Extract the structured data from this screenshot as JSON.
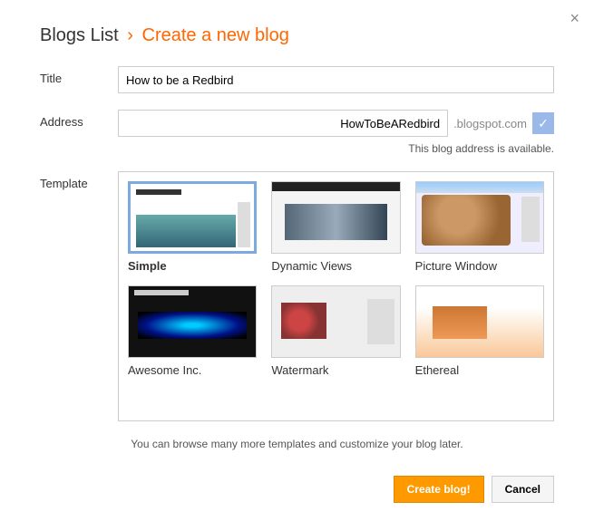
{
  "breadcrumb": {
    "prev": "Blogs List",
    "sep": "›",
    "current": "Create a new blog"
  },
  "labels": {
    "title": "Title",
    "address": "Address",
    "template": "Template"
  },
  "title_value": "How to be a Redbird",
  "address_value": "HowToBeARedbird",
  "address_suffix": ".blogspot.com",
  "address_status": "This blog address is available.",
  "templates": [
    {
      "name": "Simple",
      "selected": true
    },
    {
      "name": "Dynamic Views",
      "selected": false
    },
    {
      "name": "Picture Window",
      "selected": false
    },
    {
      "name": "Awesome Inc.",
      "selected": false
    },
    {
      "name": "Watermark",
      "selected": false
    },
    {
      "name": "Ethereal",
      "selected": false
    }
  ],
  "hint": "You can browse many more templates and customize your blog later.",
  "buttons": {
    "create": "Create blog!",
    "cancel": "Cancel"
  },
  "close_glyph": "×",
  "check_glyph": "✓"
}
